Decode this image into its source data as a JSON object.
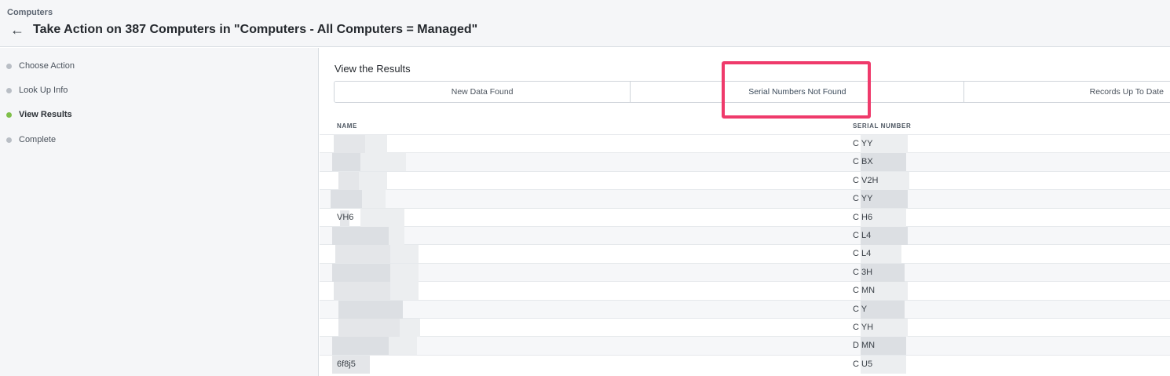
{
  "header": {
    "breadcrumb": "Computers",
    "title": "Take Action on 387 Computers in \"Computers - All Computers = Managed\""
  },
  "sidebar": {
    "steps": [
      {
        "label": "Choose Action",
        "active": false
      },
      {
        "label": "Look Up Info",
        "active": false
      },
      {
        "label": "View Results",
        "active": true
      },
      {
        "label": "Complete",
        "active": false
      }
    ]
  },
  "main": {
    "section_title": "View the Results",
    "tabs": [
      {
        "label": "New Data Found"
      },
      {
        "label": "Serial Numbers Not Found"
      },
      {
        "label": "Records Up To Date"
      }
    ],
    "columns": {
      "name": "NAME",
      "serial": "SERIAL NUMBER"
    },
    "rows": [
      {
        "name": "",
        "serial": "C            YY"
      },
      {
        "name": "",
        "serial": "C            BX"
      },
      {
        "name": "",
        "serial": "C            V2H"
      },
      {
        "name": "",
        "serial": "C            YY"
      },
      {
        "name": "                         VH6",
        "serial": "C            H6"
      },
      {
        "name": "",
        "serial": "C            L4"
      },
      {
        "name": "",
        "serial": "C            L4"
      },
      {
        "name": "",
        "serial": "C            3H"
      },
      {
        "name": "",
        "serial": "C            MN"
      },
      {
        "name": "",
        "serial": "C            Y"
      },
      {
        "name": "",
        "serial": "C            YH"
      },
      {
        "name": "",
        "serial": "D            MN"
      },
      {
        "name": "              6f8j5",
        "serial": "C            U5"
      }
    ]
  },
  "colors": {
    "highlight": "#ef3a6b",
    "active_step": "#7fbf4a",
    "inactive_step": "#b9bec5"
  }
}
